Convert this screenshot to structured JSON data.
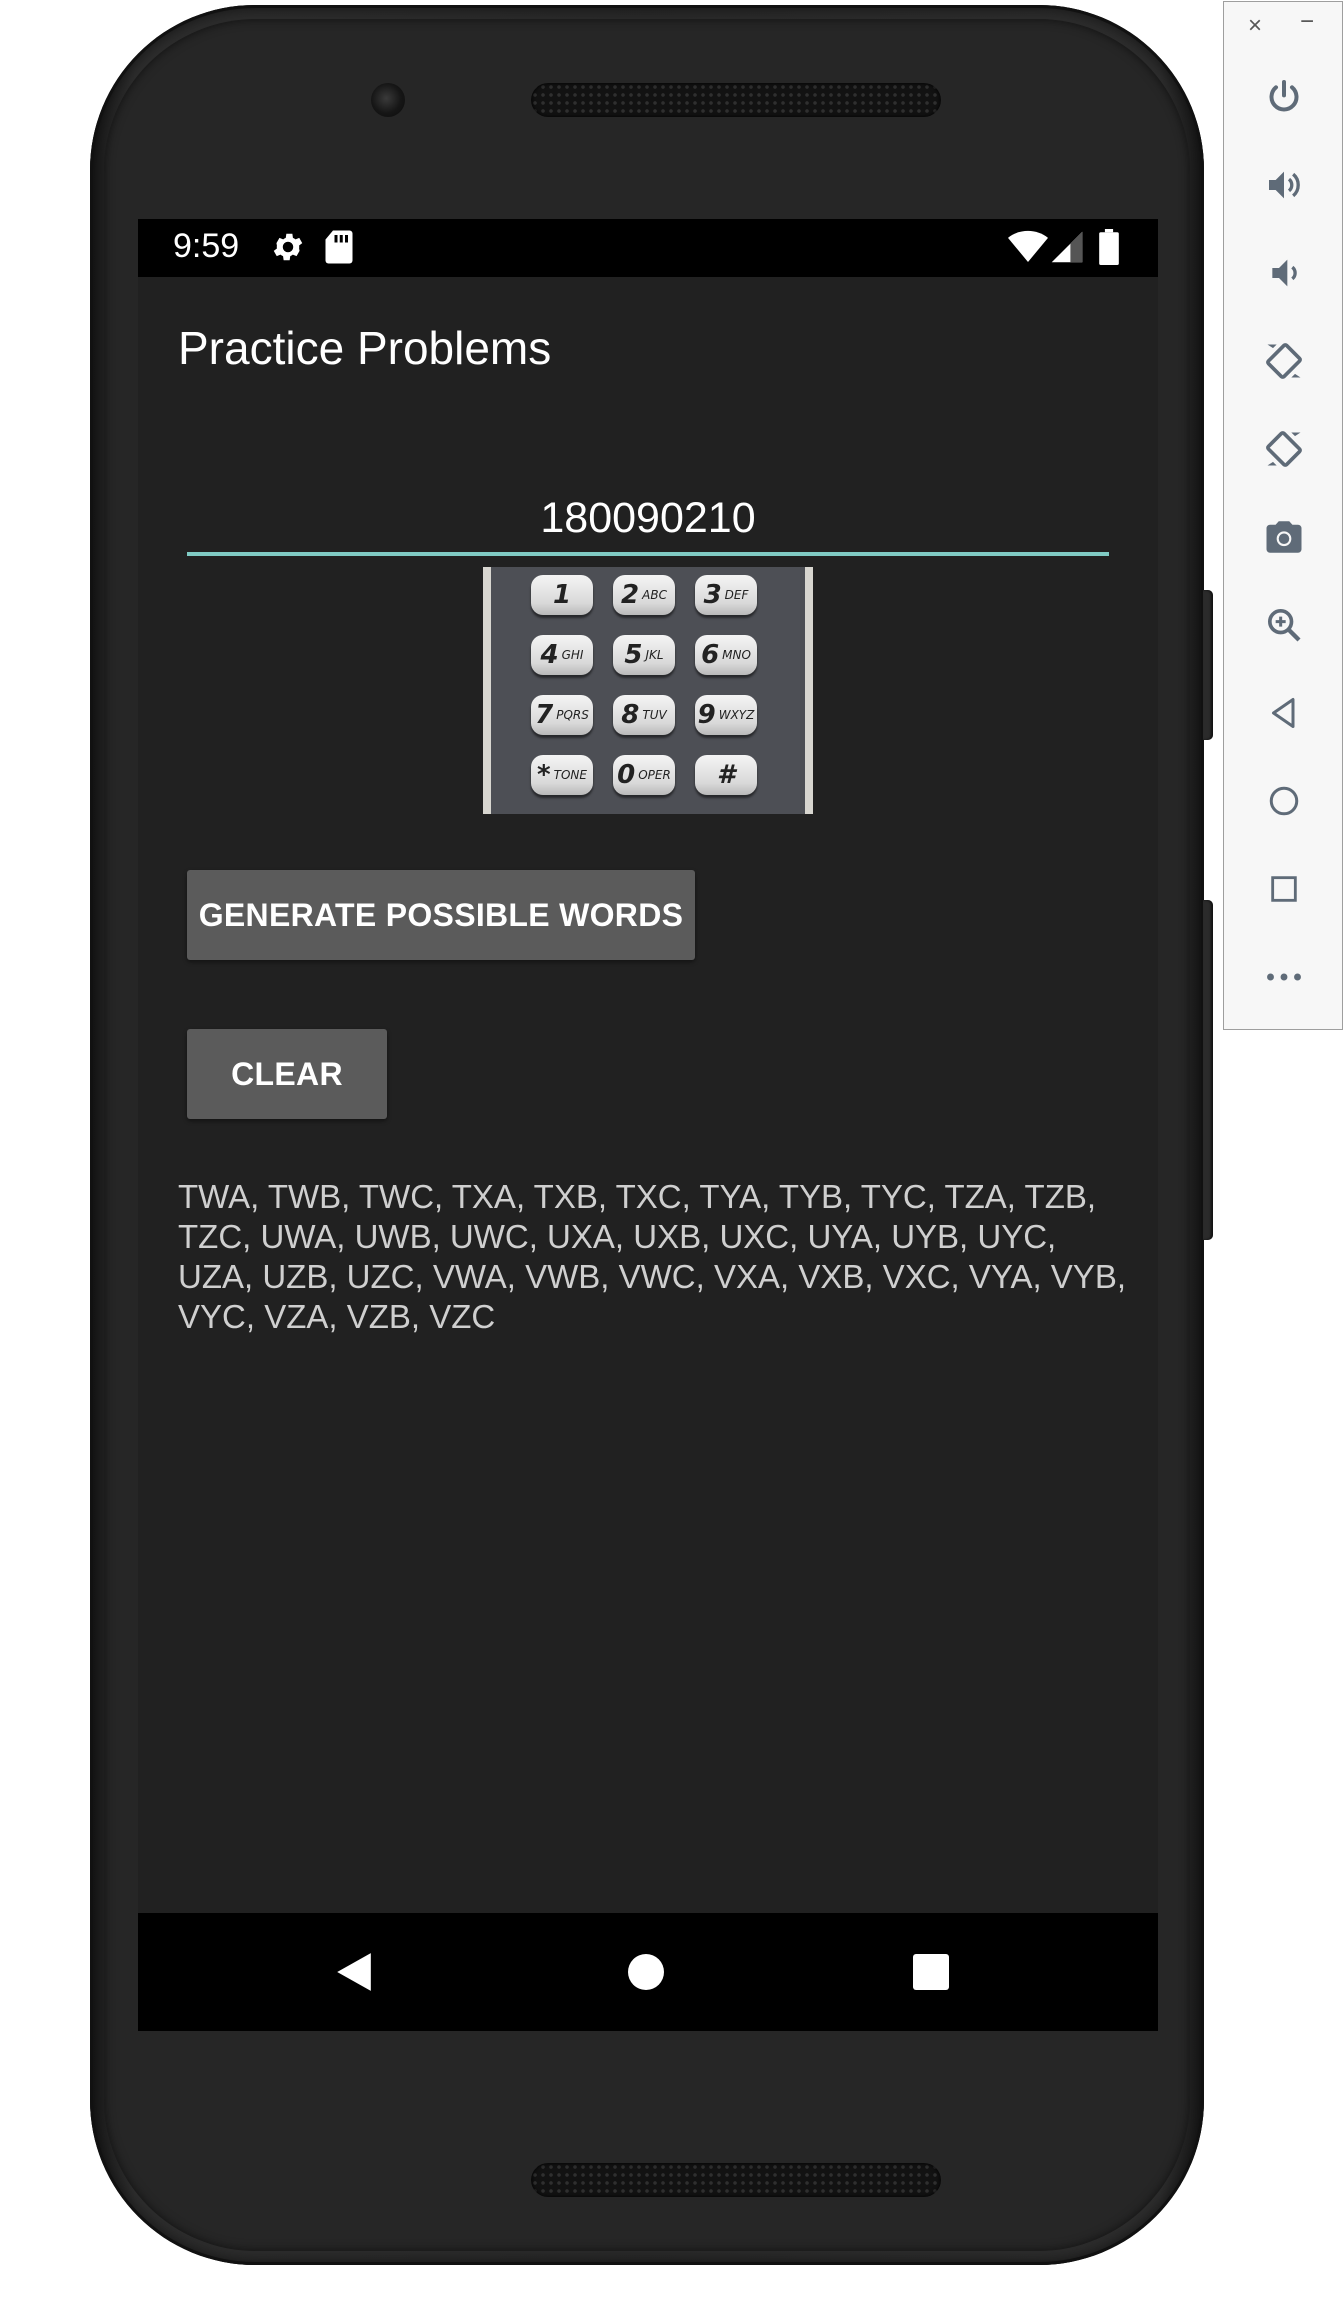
{
  "status_bar": {
    "time": "9:59",
    "icons": [
      "settings-icon",
      "sd-card-icon",
      "wifi-icon",
      "signal-icon",
      "battery-icon"
    ]
  },
  "app": {
    "title": "Practice Problems",
    "phone_number_value": "180090210",
    "keypad_image": {
      "keys": [
        {
          "digit": "1",
          "letters": ""
        },
        {
          "digit": "2",
          "letters": "ABC"
        },
        {
          "digit": "3",
          "letters": "DEF"
        },
        {
          "digit": "4",
          "letters": "GHI"
        },
        {
          "digit": "5",
          "letters": "JKL"
        },
        {
          "digit": "6",
          "letters": "MNO"
        },
        {
          "digit": "7",
          "letters": "PQRS"
        },
        {
          "digit": "8",
          "letters": "TUV"
        },
        {
          "digit": "9",
          "letters": "WXYZ"
        },
        {
          "digit": "*",
          "letters": "TONE"
        },
        {
          "digit": "0",
          "letters": "OPER"
        },
        {
          "digit": "#",
          "letters": ""
        }
      ]
    },
    "generate_button_label": "GENERATE POSSIBLE WORDS",
    "clear_button_label": "CLEAR",
    "results_text": "TWA, TWB, TWC, TXA, TXB, TXC, TYA, TYB, TYC, TZA, TZB, TZC, UWA, UWB, UWC, UXA, UXB, UXC, UYA, UYB, UYC, UZA, UZB, UZC, VWA, VWB, VWC, VXA, VXB, VXC, VYA, VYB, VYC, VZA, VZB, VZC"
  },
  "nav_bar": {
    "buttons": [
      "back-icon",
      "home-icon",
      "recents-icon"
    ]
  },
  "emulator_toolbar": {
    "close_glyph": "×",
    "minimize_glyph": "−",
    "buttons": [
      "power-icon",
      "volume-up-icon",
      "volume-down-icon",
      "rotate-left-icon",
      "rotate-right-icon",
      "camera-icon",
      "zoom-icon",
      "back-icon",
      "home-icon",
      "overview-icon",
      "more-icon"
    ]
  },
  "colors": {
    "screen_background": "#212121",
    "field_underline": "#80cbc4",
    "button_background": "#5b5b5b",
    "results_text": "#cfcfcf"
  }
}
